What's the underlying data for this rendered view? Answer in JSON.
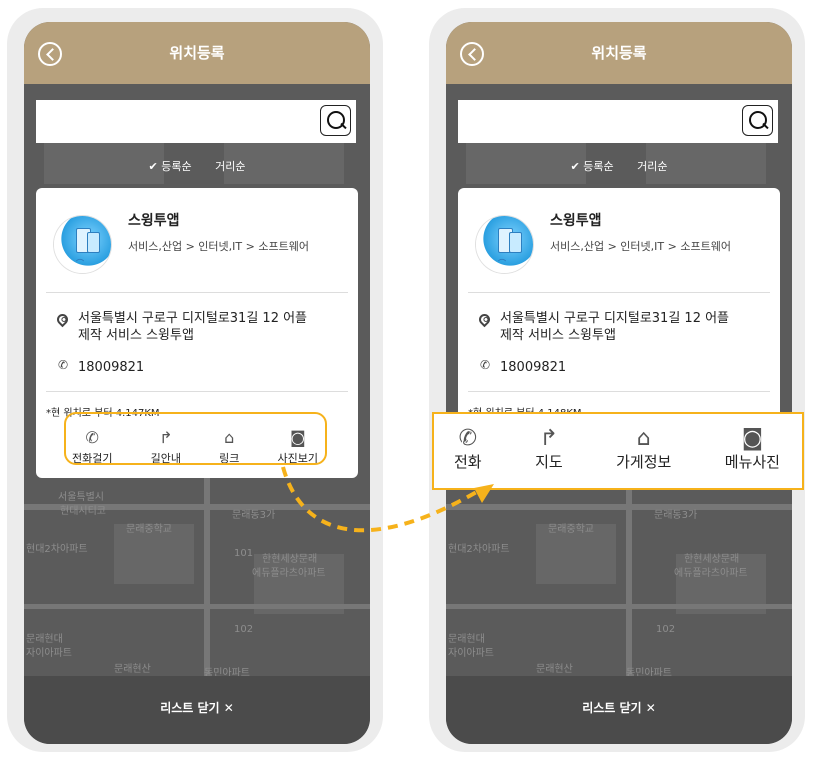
{
  "screens": [
    {
      "title": "위치등록",
      "search": {
        "placeholder": ""
      },
      "sort": {
        "by_registration": "✔ 등록순",
        "by_distance": "거리순"
      },
      "business": {
        "name": "스윙투앱",
        "category": "서비스,산업 > 인터넷,IT > 소프트웨어",
        "address_line1": "서울특별시 구로구 디지털로31길 12 어플",
        "address_line2": "제작 서비스 스윙투앱",
        "phone": "18009821",
        "distance": "*현 위치로 부터 4.147KM"
      },
      "actions": [
        {
          "icon": "phone-icon",
          "label": "전화걸기"
        },
        {
          "icon": "turn-arrow-icon",
          "label": "길안내"
        },
        {
          "icon": "home-icon",
          "label": "링크"
        },
        {
          "icon": "camera-icon",
          "label": "사진보기"
        }
      ],
      "close_label": "리스트 닫기 ✕"
    },
    {
      "title": "위치등록",
      "search": {
        "placeholder": ""
      },
      "sort": {
        "by_registration": "✔ 등록순",
        "by_distance": "거리순"
      },
      "business": {
        "name": "스윙투앱",
        "category": "서비스,산업 > 인터넷,IT > 소프트웨어",
        "address_line1": "서울특별시 구로구 디지털로31길 12 어플",
        "address_line2": "제작 서비스 스윙투앱",
        "phone": "18009821",
        "distance": "*현 위치로 부터 4.148KM"
      },
      "actions": [
        {
          "icon": "phone-icon",
          "label": "전화"
        },
        {
          "icon": "turn-arrow-icon",
          "label": "지도"
        },
        {
          "icon": "home-icon",
          "label": "가게정보"
        },
        {
          "icon": "camera-icon",
          "label": "메뉴사진"
        }
      ],
      "close_label": "리스트 닫기 ✕"
    }
  ],
  "map_labels": [
    "서울특별시",
    "현대시티코",
    "문래중학교",
    "문래동3가",
    "현대2차아파트",
    "한현세상문래",
    "에듀플라츠아파트",
    "문래현대",
    "자이아파트",
    "문래현산",
    "아파트",
    "동민아파트",
    "101",
    "102",
    "문래롯데캐슬"
  ],
  "colors": {
    "header": "#b7a17d",
    "highlight": "#f6b21b",
    "overlay": "#5f5f5f"
  }
}
